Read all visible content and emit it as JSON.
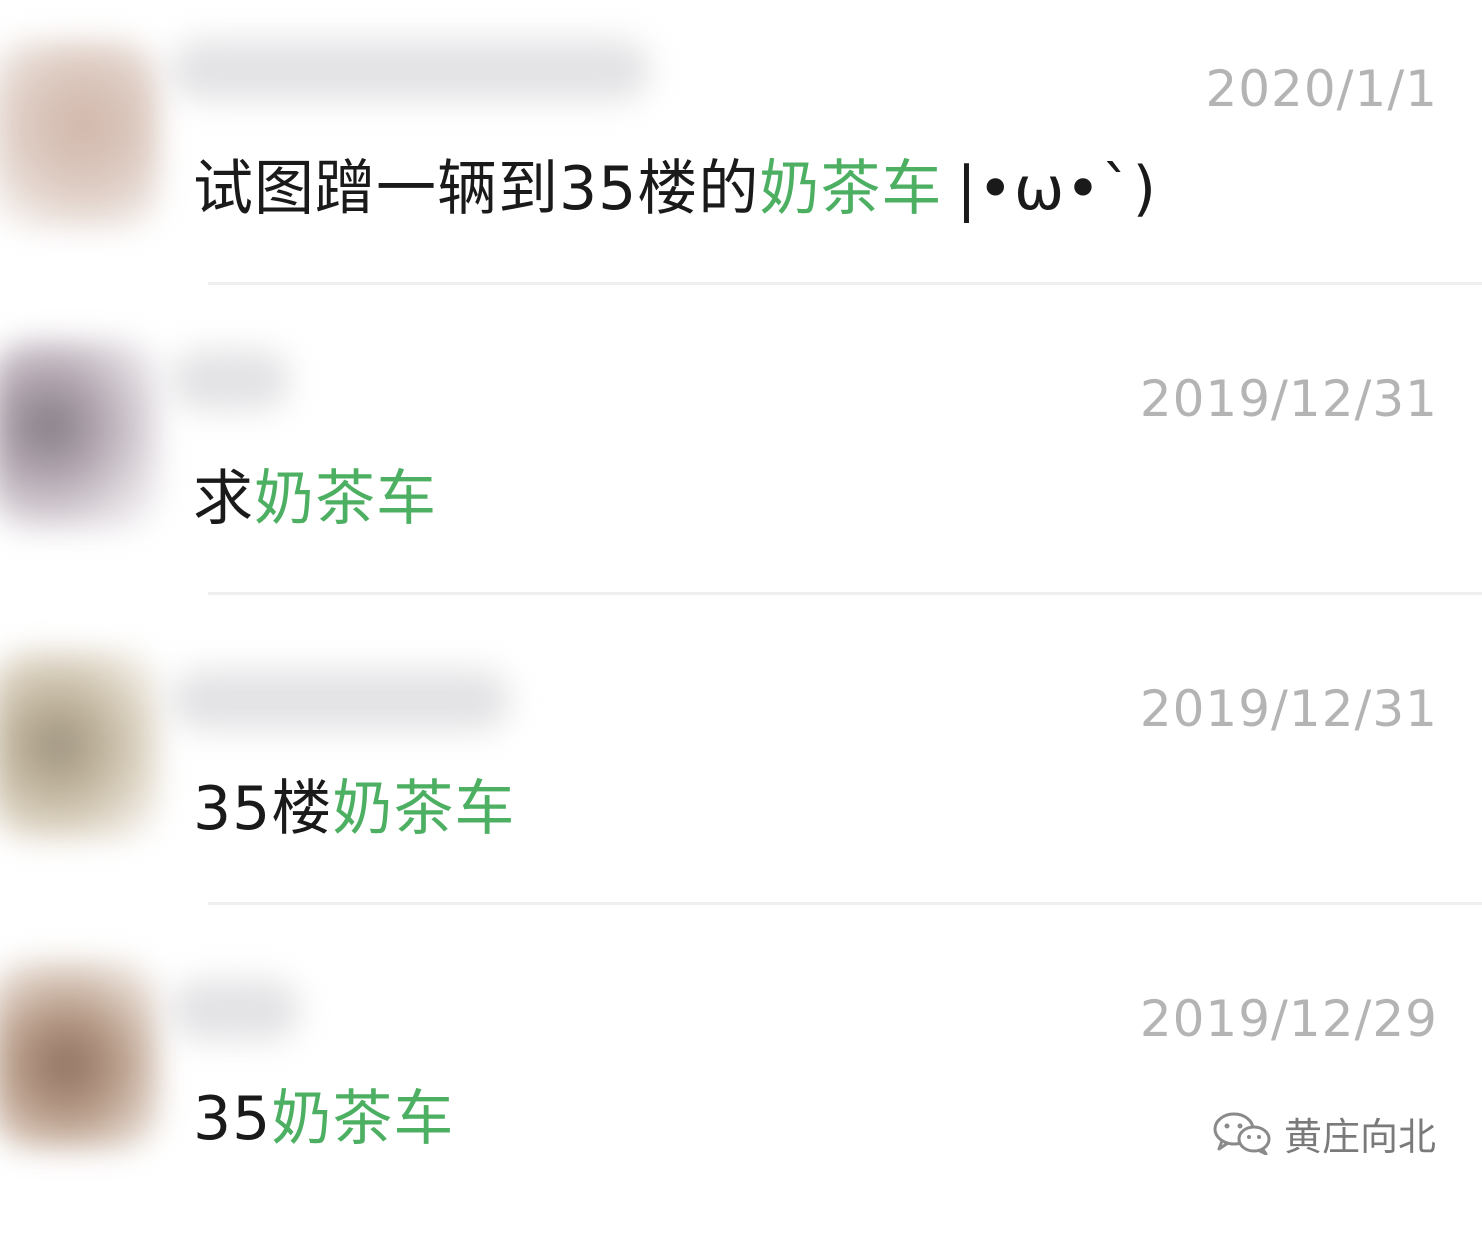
{
  "comments": [
    {
      "prefix": "试图蹭一辆到35楼的",
      "keyword": "奶茶车",
      "suffix": "|•ω•`)",
      "date": "2020/1/1"
    },
    {
      "prefix": "求",
      "keyword": "奶茶车",
      "suffix": "",
      "date": "2019/12/31"
    },
    {
      "prefix": "35楼",
      "keyword": "奶茶车",
      "suffix": "",
      "date": "2019/12/31"
    },
    {
      "prefix": "35",
      "keyword": "奶茶车",
      "suffix": "",
      "date": "2019/12/29"
    }
  ],
  "watermark": {
    "icon": "wechat-icon",
    "label": "黄庄向北"
  },
  "colors": {
    "keyword": "#4caf62",
    "text": "#1a1a1a",
    "date": "#b4b4b4",
    "divider": "#efefef"
  }
}
